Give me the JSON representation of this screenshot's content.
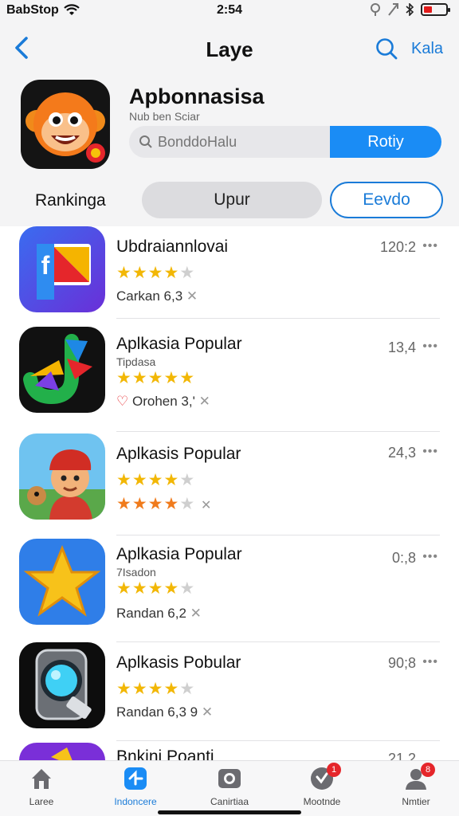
{
  "status_bar": {
    "carrier": "BabStop",
    "time": "2:54",
    "icons": [
      "wifi-icon",
      "location-icon",
      "signal-icon",
      "bluetooth-icon",
      "battery-icon"
    ],
    "battery_color": "#e21b1b"
  },
  "nav": {
    "title": "Laye",
    "back_icon": "chevron-left-icon",
    "search_icon": "search-icon",
    "action_label": "Kala"
  },
  "app": {
    "name": "Apbonnasisa",
    "subtitle": "Nub ben Sciar",
    "search_placeholder": "BonddoHalu",
    "action_button": "Rotiy",
    "icon": "monkey-face-icon"
  },
  "ranking": {
    "label": "Rankinga",
    "segments": [
      "Upur",
      "Eevdo"
    ]
  },
  "colors": {
    "accent": "#1a8cf5",
    "link": "#1a7bd8",
    "star": "#f2b705",
    "star_orange": "#f07b1c",
    "badge": "#e5262b"
  },
  "list": [
    {
      "title": "Ubdraiannlovai",
      "subtitle": "",
      "rating": 4,
      "meta": "Carkan 6,3",
      "num": "120:2",
      "icon": "f-flag-icon"
    },
    {
      "title": "Aplkasia Popular",
      "subtitle": "Tipdasa",
      "rating": 5,
      "meta": "Orohen 3,'",
      "num": "13,4",
      "icon": "colorful-j-icon"
    },
    {
      "title": "Aplkasis Popular",
      "subtitle": "",
      "rating": 4,
      "meta": "",
      "num": "24,3",
      "icon": "cartoon-boy-icon",
      "rating2": 4
    },
    {
      "title": "Aplkasia Popular",
      "subtitle": "7Isadon",
      "rating": 4,
      "meta": "Randan 6,2",
      "num": "0:,8",
      "icon": "star-icon"
    },
    {
      "title": "Aplkasis Pobular",
      "subtitle": "",
      "rating": 4,
      "meta": "Randan 6,3 9",
      "num": "90;8",
      "icon": "camera-lens-icon"
    },
    {
      "title": "Bnkini Poanti",
      "subtitle": "",
      "rating": 0,
      "meta": "",
      "num": "21,2",
      "icon": "purple-app-icon"
    }
  ],
  "tabbar": [
    {
      "label": "Laree",
      "icon": "house-icon",
      "active": false
    },
    {
      "label": "Indoncere",
      "icon": "today-icon",
      "active": true
    },
    {
      "label": "Canirtiaa",
      "icon": "camera-icon",
      "active": false
    },
    {
      "label": "Mootnde",
      "icon": "clock-icon",
      "active": false,
      "badge": "1"
    },
    {
      "label": "Nmtier",
      "icon": "person-icon",
      "active": false,
      "badge": "8"
    }
  ]
}
